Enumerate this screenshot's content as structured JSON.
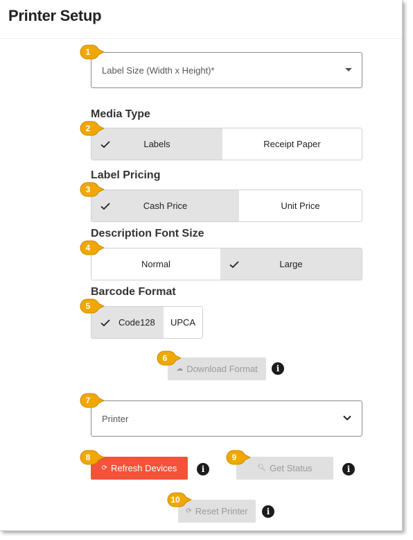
{
  "page": {
    "title": "Printer Setup"
  },
  "label_size": {
    "placeholder": "Label Size (Width x Height)*",
    "icon": "caret-down-icon"
  },
  "media_type": {
    "label": "Media Type",
    "options": [
      "Labels",
      "Receipt Paper"
    ],
    "selected": "Labels"
  },
  "label_pricing": {
    "label": "Label Pricing",
    "options": [
      "Cash Price",
      "Unit Price"
    ],
    "selected": "Cash Price"
  },
  "description_font_size": {
    "label": "Description Font Size",
    "options": [
      "Normal",
      "Large"
    ],
    "selected": "Large"
  },
  "barcode_format": {
    "label": "Barcode Format",
    "options": [
      "Code128",
      "UPCA"
    ],
    "selected": "Code128"
  },
  "buttons": {
    "download_format": "Download Format",
    "refresh_devices": "Refresh Devices",
    "get_status": "Get Status",
    "reset_printer": "Reset Printer"
  },
  "printer": {
    "placeholder": "Printer",
    "icon": "chevron-down-icon"
  },
  "info_glyph": "i",
  "callouts": [
    "1",
    "2",
    "3",
    "4",
    "5",
    "6",
    "7",
    "8",
    "9",
    "10"
  ],
  "colors": {
    "callout": "#f0a800",
    "refresh_button": "#f4533a",
    "selected_option": "#e3e3e3",
    "disabled_button": "#e0e0e0"
  }
}
